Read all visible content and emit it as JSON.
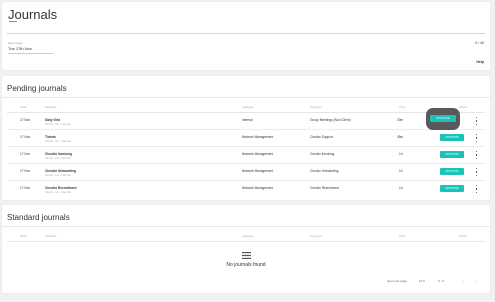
{
  "header": {
    "title": "Journals",
    "date_label": "Date range",
    "date_value": "Tue 17th Nov",
    "count": "0 / 40",
    "help": "Help"
  },
  "columns": [
    "Date",
    "Services",
    "Category",
    "Tool type",
    "Time",
    "Action"
  ],
  "pending": {
    "title": "Pending journals",
    "rows": [
      {
        "date": "17 Nov",
        "service": "Daily Grid",
        "sub": "Circuit - Uk - Internal",
        "category": "Internal",
        "tool": "Group Meetings (Non Client)",
        "time": "20m",
        "approve": "APPROVE"
      },
      {
        "date": "17 Nov",
        "service": "Tickets",
        "sub": "Circuit - Uk - Internal",
        "category": "Network Management",
        "tool": "Circutio Support",
        "time": "45m",
        "approve": "APPROVE"
      },
      {
        "date": "17 Nov",
        "service": "Circutio Invoicing",
        "sub": "Circuit - Uk - Internal",
        "category": "Network Management",
        "tool": "Circutio Invoicing",
        "time": "1h",
        "approve": "APPROVE"
      },
      {
        "date": "17 Nov",
        "service": "Circutio Onboarding",
        "sub": "Circuit - Uk - Internal",
        "category": "Network Management",
        "tool": "Circutio Onboarding",
        "time": "1h",
        "approve": "APPROVE"
      },
      {
        "date": "17 Nov",
        "service": "Circutio Recruitment",
        "sub": "Circuit - Uk - Internal",
        "category": "Network Management",
        "tool": "Circutio Recruitment",
        "time": "1h",
        "approve": "APPROVE"
      }
    ]
  },
  "standard": {
    "title": "Standard journals",
    "empty": "No journals found",
    "rows_per_page_label": "Items per page",
    "rows_per_page": "10",
    "range": "0 - 0"
  },
  "colors": {
    "accent": "#19c3b8"
  }
}
